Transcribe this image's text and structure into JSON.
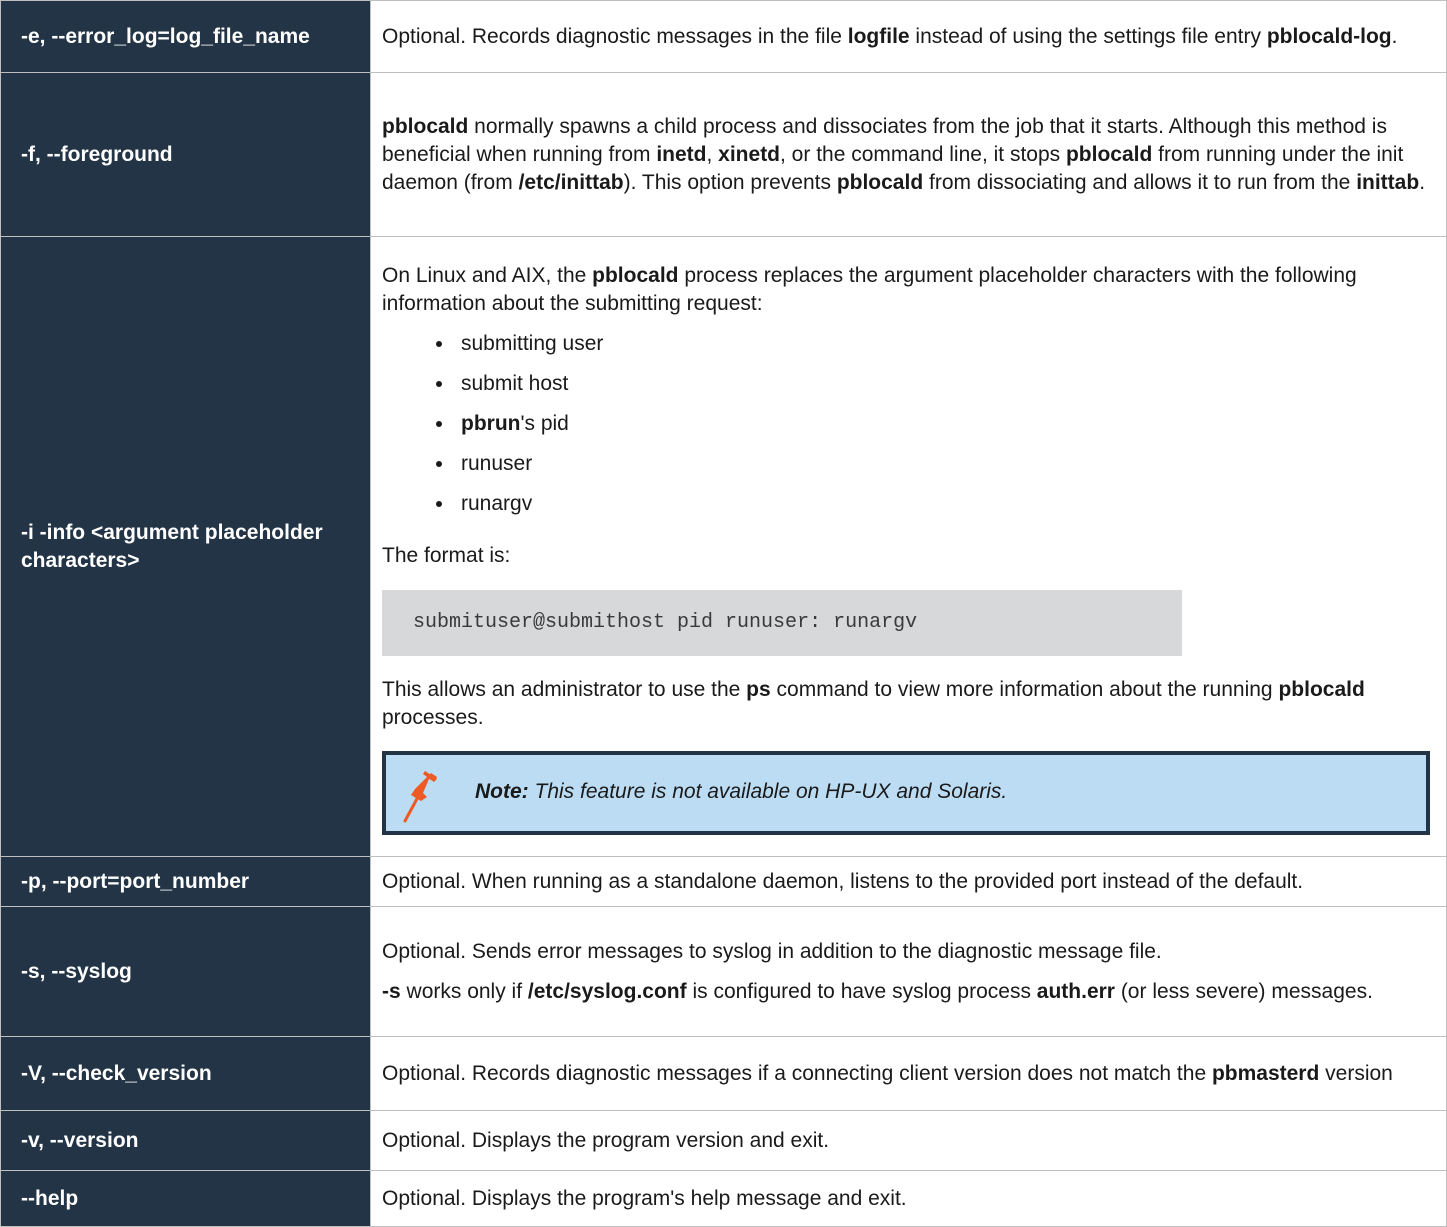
{
  "rows": [
    {
      "option": "-e, --error_log=log_file_name",
      "desc": [
        "Optional. Records diagnostic messages in the file ",
        {
          "b": "logfile"
        },
        " instead of using the settings file entry ",
        {
          "b": "pblocald-log"
        },
        "."
      ]
    },
    {
      "option": "-f, --foreground",
      "desc": [
        {
          "b": "pblocald"
        },
        " normally spawns a child process and dissociates from the job that it starts. Although this method is beneficial when running from ",
        {
          "b": "inetd"
        },
        ", ",
        {
          "b": "xinetd"
        },
        ", or the command line, it stops ",
        {
          "b": "pblocald"
        },
        " from running under the init daemon (from ",
        {
          "b": "/etc/inittab"
        },
        "). This option prevents ",
        {
          "b": "pblocald"
        },
        " from dissociating and allows it to run from the ",
        {
          "b": "inittab"
        },
        "."
      ]
    },
    {
      "option": "-i -info <argument placeholder characters>",
      "intro": [
        "On Linux and AIX, the ",
        {
          "b": "pblocald"
        },
        " process replaces the argument placeholder characters with the following information about the submitting request:"
      ],
      "bullets": [
        [
          "submitting user"
        ],
        [
          "submit host"
        ],
        [
          {
            "b": "pbrun"
          },
          "'s pid"
        ],
        [
          "runuser"
        ],
        [
          "runargv"
        ]
      ],
      "format_label": "The format is:",
      "code": "submituser@submithost pid runuser: runargv",
      "after": [
        "This allows an administrator to use the ",
        {
          "b": "ps"
        },
        " command to view more information about the running ",
        {
          "b": "pblocald"
        },
        " processes."
      ],
      "note": {
        "icon": "pushpin-icon",
        "label": "Note:",
        "text": " This feature is not available on HP-UX and Solaris."
      }
    },
    {
      "option": "-p, --port=port_number",
      "desc": [
        "Optional. When running as a standalone daemon, listens to the provided port instead of the default."
      ]
    },
    {
      "option": "-s, --syslog",
      "desc": [
        "Optional. Sends error messages to syslog in addition to the diagnostic message file."
      ],
      "desc2": [
        {
          "b": "-s"
        },
        " works only if ",
        {
          "b": "/etc/syslog.conf"
        },
        " is configured to have syslog process ",
        {
          "b": "auth.err"
        },
        " (or less severe) messages."
      ]
    },
    {
      "option": "-V, --check_version",
      "desc": [
        "Optional. Records diagnostic messages if a connecting client version does not match the ",
        {
          "b": "pbmasterd"
        },
        " version"
      ]
    },
    {
      "option": "-v, --version",
      "desc": [
        "Optional. Displays the program version and exit."
      ]
    },
    {
      "option": "--help",
      "desc": [
        "Optional. Displays the program's help message and exit."
      ]
    }
  ],
  "colors": {
    "key_bg": "#233446",
    "note_bg": "#bcdcf4",
    "code_bg": "#d6d8da",
    "pin": "#ee5a24"
  }
}
